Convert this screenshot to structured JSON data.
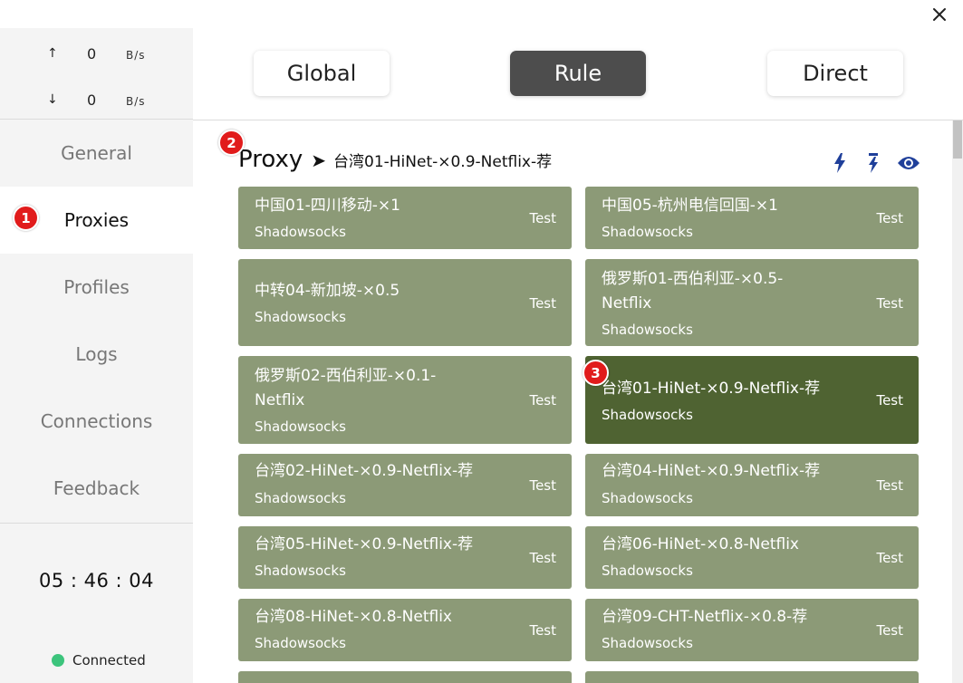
{
  "window": {
    "close_icon": "close-icon"
  },
  "traffic": {
    "up": {
      "arrow": "↑",
      "value": "0",
      "unit": "B/s"
    },
    "down": {
      "arrow": "↓",
      "value": "0",
      "unit": "B/s"
    }
  },
  "nav": {
    "items": [
      {
        "label": "General"
      },
      {
        "label": "Proxies"
      },
      {
        "label": "Profiles"
      },
      {
        "label": "Logs"
      },
      {
        "label": "Connections"
      },
      {
        "label": "Feedback"
      }
    ],
    "active": "Proxies"
  },
  "clock": "05 : 46 : 04",
  "status": {
    "label": "Connected",
    "color": "#3cc47c"
  },
  "modes": {
    "global": "Global",
    "rule": "Rule",
    "direct": "Direct",
    "active": "Rule"
  },
  "group": {
    "name": "Proxy",
    "separator": "➤",
    "selected": "台湾01-HiNet-×0.9-Netflix-荐",
    "icons": [
      "bolt-icon",
      "bolt-filled-icon",
      "eye-icon"
    ]
  },
  "cards": [
    {
      "name": "中国01-四川移动-×1",
      "type": "Shadowsocks",
      "test": "Test"
    },
    {
      "name": "中国05-杭州电信回国-×1",
      "type": "Shadowsocks",
      "test": "Test"
    },
    {
      "name": "中转04-新加坡-×0.5",
      "type": "Shadowsocks",
      "test": "Test"
    },
    {
      "name": "俄罗斯01-西伯利亚-×0.5-Netflix",
      "type": "Shadowsocks",
      "test": "Test"
    },
    {
      "name": "俄罗斯02-西伯利亚-×0.1-Netflix",
      "type": "Shadowsocks",
      "test": "Test"
    },
    {
      "name": "台湾01-HiNet-×0.9-Netflix-荐",
      "type": "Shadowsocks",
      "test": "Test"
    },
    {
      "name": "台湾02-HiNet-×0.9-Netflix-荐",
      "type": "Shadowsocks",
      "test": "Test"
    },
    {
      "name": "台湾04-HiNet-×0.9-Netflix-荐",
      "type": "Shadowsocks",
      "test": "Test"
    },
    {
      "name": "台湾05-HiNet-×0.9-Netflix-荐",
      "type": "Shadowsocks",
      "test": "Test"
    },
    {
      "name": "台湾06-HiNet-×0.8-Netflix",
      "type": "Shadowsocks",
      "test": "Test"
    },
    {
      "name": "台湾08-HiNet-×0.8-Netflix",
      "type": "Shadowsocks",
      "test": "Test"
    },
    {
      "name": "台湾09-CHT-Netflix-×0.8-荐",
      "type": "Shadowsocks",
      "test": "Test"
    }
  ],
  "badges": {
    "one": "1",
    "two": "2",
    "three": "3"
  },
  "colors": {
    "card": "#8c9a77",
    "card_selected": "#4f6332",
    "badge": "#e11b1b",
    "icon": "#1f3f9a"
  }
}
